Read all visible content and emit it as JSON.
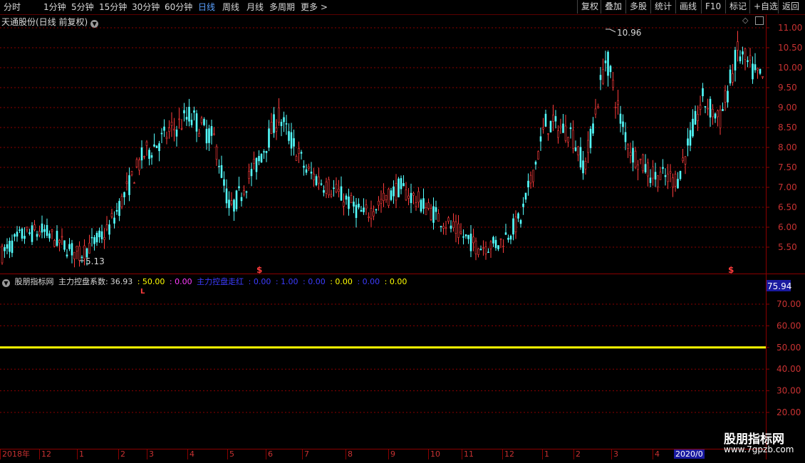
{
  "toolbar": {
    "left": [
      "分时",
      "1分钟",
      "5分钟",
      "15分钟",
      "30分钟",
      "60分钟",
      "日线",
      "周线",
      "月线",
      "多周期",
      "更多"
    ],
    "active_index": 6,
    "right": [
      "复权",
      "叠加",
      "多股",
      "统计",
      "画线",
      "F10",
      "标记",
      "+自选",
      "返回"
    ]
  },
  "stock": {
    "title": "天通股份(日线 前复权)"
  },
  "price_panel": {
    "high_label": "10.96",
    "low_label": "5.13",
    "signal_glyph": "$",
    "right_ticks": [
      "11.00",
      "10.50",
      "10.00",
      "9.50",
      "9.00",
      "8.50",
      "8.00",
      "7.50",
      "7.00",
      "6.50",
      "6.00",
      "5.50"
    ],
    "colors": {
      "up": "#ff3c3c",
      "down": "#54ffff",
      "grid": "#8b0000"
    }
  },
  "indicator": {
    "name": "股朋指标网",
    "line1_label": "主力控盘系数:",
    "line1_value": "36.93",
    "v2": ": 50.00",
    "v3": ": 0.00",
    "line2_label": "主力控盘走红",
    "v4": ": 0.00",
    "v5": ": 1.00",
    "v6": ": 0.00",
    "v7": ": 0.00",
    "v8": ": 0.00",
    "v9": ": 0.00",
    "marker": "L",
    "current_value": "75.94",
    "ticks": [
      "70.00",
      "60.00",
      "50.00",
      "40.00",
      "30.00",
      "20.00"
    ],
    "level_line": 50,
    "line_color": "#ffff00"
  },
  "date_axis": [
    "2018年",
    "12",
    "1",
    "2",
    "3",
    "4",
    "5",
    "6",
    "7",
    "8",
    "9",
    "10",
    "11",
    "12",
    "1",
    "2",
    "3",
    "4"
  ],
  "date_axis_end": "2020/0",
  "watermark": {
    "name": "股朋指标网",
    "url": "www.7gpzb.com"
  }
}
